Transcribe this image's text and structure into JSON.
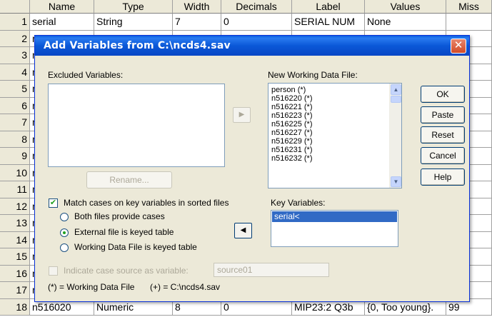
{
  "grid": {
    "columns": [
      "Name",
      "Type",
      "Width",
      "Decimals",
      "Label",
      "Values",
      "Miss"
    ],
    "rows": [
      {
        "n": "1",
        "name": "serial",
        "type": "String",
        "width": "7",
        "decimals": "0",
        "label": "SERIAL NUM",
        "values": "None",
        "miss": ""
      },
      {
        "n": "2",
        "name": "n",
        "type": "",
        "width": "",
        "decimals": "",
        "label": "",
        "values": "",
        "miss": "e"
      },
      {
        "n": "3",
        "name": "n",
        "type": "",
        "width": "",
        "decimals": "",
        "label": "",
        "values": "",
        "miss": ""
      },
      {
        "n": "4",
        "name": "n",
        "type": "",
        "width": "",
        "decimals": "",
        "label": "",
        "values": "",
        "miss": "e"
      },
      {
        "n": "5",
        "name": "n",
        "type": "",
        "width": "",
        "decimals": "",
        "label": "",
        "values": "",
        "miss": "e"
      },
      {
        "n": "6",
        "name": "n",
        "type": "",
        "width": "",
        "decimals": "",
        "label": "",
        "values": "",
        "miss": "e"
      },
      {
        "n": "7",
        "name": "n",
        "type": "",
        "width": "",
        "decimals": "",
        "label": "",
        "values": "",
        "miss": "e"
      },
      {
        "n": "8",
        "name": "n",
        "type": "",
        "width": "",
        "decimals": "",
        "label": "",
        "values": "",
        "miss": "e"
      },
      {
        "n": "9",
        "name": "n",
        "type": "",
        "width": "",
        "decimals": "",
        "label": "",
        "values": "",
        "miss": ""
      },
      {
        "n": "10",
        "name": "n",
        "type": "",
        "width": "",
        "decimals": "",
        "label": "",
        "values": "",
        "miss": "e"
      },
      {
        "n": "11",
        "name": "n",
        "type": "",
        "width": "",
        "decimals": "",
        "label": "",
        "values": "",
        "miss": "e"
      },
      {
        "n": "12",
        "name": "n",
        "type": "",
        "width": "",
        "decimals": "",
        "label": "",
        "values": "",
        "miss": "e"
      },
      {
        "n": "13",
        "name": "n",
        "type": "",
        "width": "",
        "decimals": "",
        "label": "",
        "values": "",
        "miss": "e"
      },
      {
        "n": "14",
        "name": "n",
        "type": "",
        "width": "",
        "decimals": "",
        "label": "",
        "values": "",
        "miss": ""
      },
      {
        "n": "15",
        "name": "n",
        "type": "",
        "width": "",
        "decimals": "",
        "label": "",
        "values": "",
        "miss": ""
      },
      {
        "n": "16",
        "name": "n",
        "type": "",
        "width": "",
        "decimals": "",
        "label": "",
        "values": "",
        "miss": ""
      },
      {
        "n": "17",
        "name": "n",
        "type": "",
        "width": "",
        "decimals": "",
        "label": "",
        "values": "",
        "miss": ""
      },
      {
        "n": "18",
        "name": "n516020",
        "type": "Numeric",
        "width": "8",
        "decimals": "0",
        "label": "MIP23:2 Q3b",
        "values": "{0, Too young}.",
        "miss": "99"
      }
    ]
  },
  "dialog": {
    "title": "Add Variables from C:\\ncds4.sav",
    "close_icon": "close-icon",
    "excluded_label": "Excluded Variables:",
    "new_working_label": "New Working Data File:",
    "new_working_items": [
      "person (*)",
      "n516220 (*)",
      "n516221 (*)",
      "n516223 (*)",
      "n516225 (*)",
      "n516227 (*)",
      "n516229 (*)",
      "n516231 (*)",
      "n516232 (*)"
    ],
    "key_variables_label": "Key Variables:",
    "key_variables_items": [
      "serial<"
    ],
    "buttons": {
      "ok": "OK",
      "paste": "Paste",
      "reset": "Reset",
      "cancel": "Cancel",
      "help": "Help"
    },
    "rename_button": "Rename...",
    "match_cases_label": "Match cases on key variables in sorted files",
    "match_cases_checked": true,
    "radios": [
      {
        "label": "Both files provide cases",
        "selected": false
      },
      {
        "label": "External file is keyed table",
        "selected": true
      },
      {
        "label": "Working Data File is keyed table",
        "selected": false
      }
    ],
    "indicate_label": "Indicate case source as variable:",
    "indicate_value": "source01",
    "footnote_working": "(*) = Working Data File",
    "footnote_plus": "(+) = C:\\ncds4.sav"
  },
  "colors": {
    "title_bar": "#0a58d8",
    "dialog_bg": "#ece9d8",
    "selected_item": "#316ac5"
  }
}
